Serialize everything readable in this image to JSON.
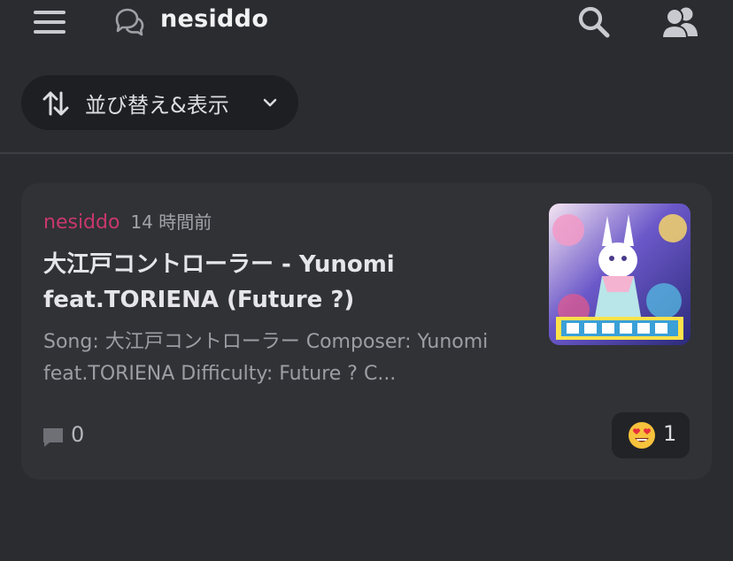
{
  "header": {
    "menu_icon": "hamburger-menu-icon",
    "forum_icon": "forum-chat-icon",
    "title": "nesiddo",
    "search_icon": "search-icon",
    "members_icon": "members-icon"
  },
  "sort_filter": {
    "icon": "sort-arrows-icon",
    "label": "並び替え&表示",
    "chevron": "chevron-down-icon"
  },
  "post": {
    "author": "nesiddo",
    "time": "14 時間前",
    "title": "大江戸コントローラー - Yunomi feat.TORIENA (Future ?)",
    "snippet": "Song: 大江戸コントローラー Composer: Yunomi feat.TORIENA Difficulty: Future ? C...",
    "thumbnail": "album-art-thumbnail",
    "comment_count": "0",
    "reaction": {
      "emoji": "heart-eyes-emoji",
      "count": "1"
    }
  },
  "colors": {
    "background": "#2b2c30",
    "card": "#313236",
    "author": "#c9376d",
    "sort_button": "#1e1f22"
  }
}
